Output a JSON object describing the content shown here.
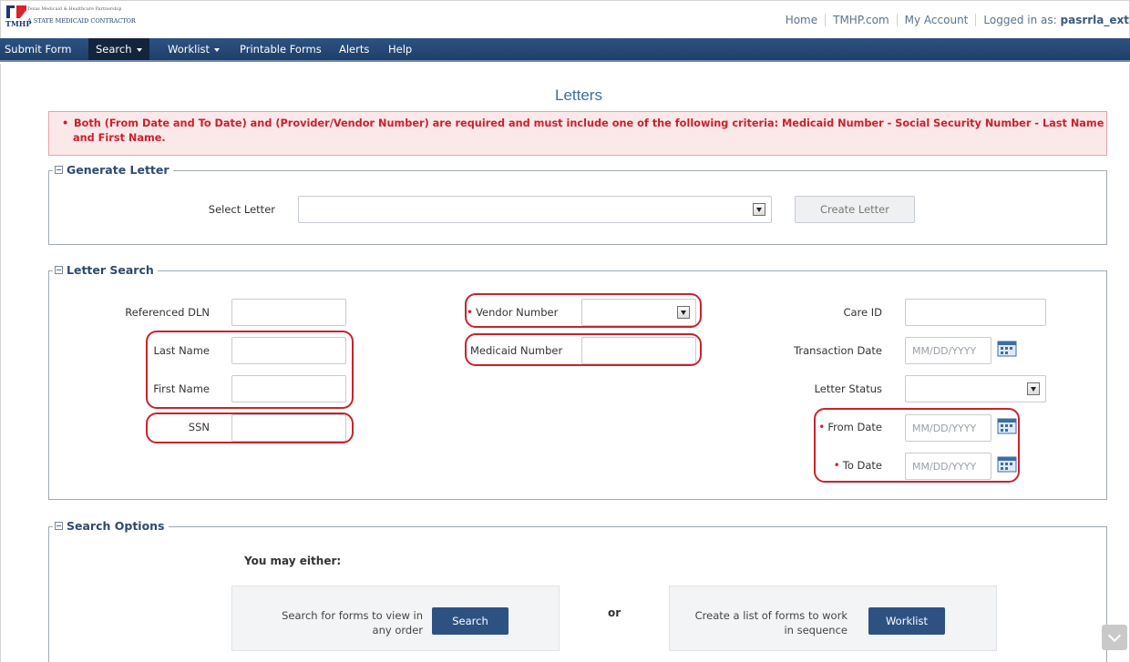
{
  "brand": {
    "name": "TMHP",
    "line1": "Texas Medicaid & Healthcare Partnership",
    "line2": "A STATE MEDICAID CONTRACTOR",
    "red": "#d9232d",
    "navy": "#1b3a70"
  },
  "top_links": {
    "home": "Home",
    "tmhp": "TMHP.com",
    "account": "My Account",
    "logged_in_label": "Logged in as:",
    "username": "pasrrla_ext"
  },
  "nav": {
    "items": [
      {
        "label": "Submit Form"
      },
      {
        "label": "Search",
        "dropdown": true,
        "active": true
      },
      {
        "label": "Worklist",
        "dropdown": true
      },
      {
        "label": "Printable Forms"
      },
      {
        "label": "Alerts"
      },
      {
        "label": "Help"
      }
    ]
  },
  "page": {
    "title": "Letters"
  },
  "alert": {
    "line1": "Both (From Date and To Date) and (Provider/Vendor Number) are required and must include one of the following criteria: Medicaid Number - Social Security Number - Last Name",
    "line2": "and First Name.",
    "color": "#cc1f2a"
  },
  "generate_letter": {
    "legend": "Generate Letter",
    "select_label": "Select Letter",
    "select_value": "",
    "create_button": "Create Letter"
  },
  "letter_search": {
    "legend": "Letter Search",
    "referenced_dln": "Referenced DLN",
    "last_name": "Last Name",
    "first_name": "First Name",
    "ssn": "SSN",
    "vendor_number": "Vendor Number",
    "medicaid_number": "Medicaid Number",
    "care_id": "Care ID",
    "transaction_date": "Transaction Date",
    "letter_status": "Letter Status",
    "from_date": "From Date",
    "to_date": "To Date",
    "date_placeholder": "MM/DD/YYYY"
  },
  "search_options": {
    "legend": "Search Options",
    "heading": "You may either:",
    "search_text_1": "Search for forms to view in",
    "search_text_2": "any order",
    "search_button": "Search",
    "or": "or",
    "worklist_text_1": "Create a list of forms to work",
    "worklist_text_2": "in sequence",
    "worklist_button": "Worklist"
  },
  "icons": {
    "calendar": "calendar-icon",
    "expand": "minus-box-icon",
    "dropdown": "chevron-down-icon",
    "scroll": "chevron-down-icon"
  },
  "colors": {
    "nav_bg": "#1e3f68",
    "highlight": "#c8232c",
    "button_blue": "#2d5282"
  }
}
